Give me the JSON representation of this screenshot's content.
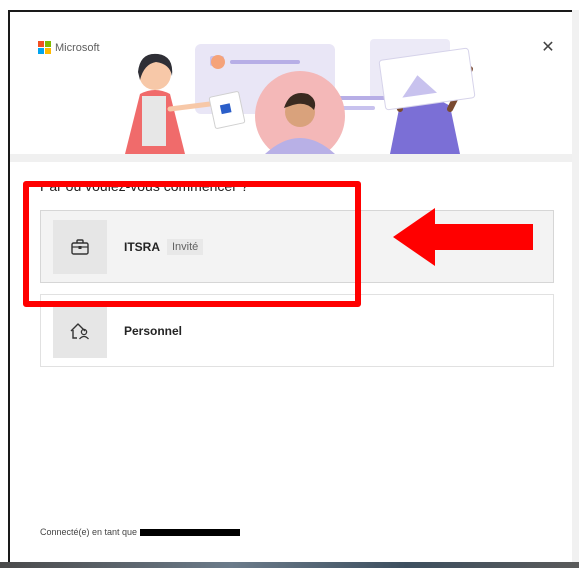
{
  "window": {
    "brand_label": "Microsoft",
    "close_symbol": "✕"
  },
  "prompt": {
    "question": "Par où voulez-vous commencer ?"
  },
  "accounts": [
    {
      "name": "ITSRA",
      "badge": "Invité",
      "icon": "briefcase-icon",
      "selected": true
    },
    {
      "name": "Personnel",
      "badge": "",
      "icon": "home-person-icon",
      "selected": false
    }
  ],
  "footer": {
    "signed_in_prefix": "Connecté(e) en tant que"
  },
  "annotation": {
    "color": "#ff0000",
    "highlight": "ITSRA account option",
    "arrow_direction": "left"
  },
  "colors": {
    "ms_red": "#f25022",
    "ms_green": "#7fba00",
    "ms_blue": "#00a4ef",
    "ms_yellow": "#ffb900"
  }
}
